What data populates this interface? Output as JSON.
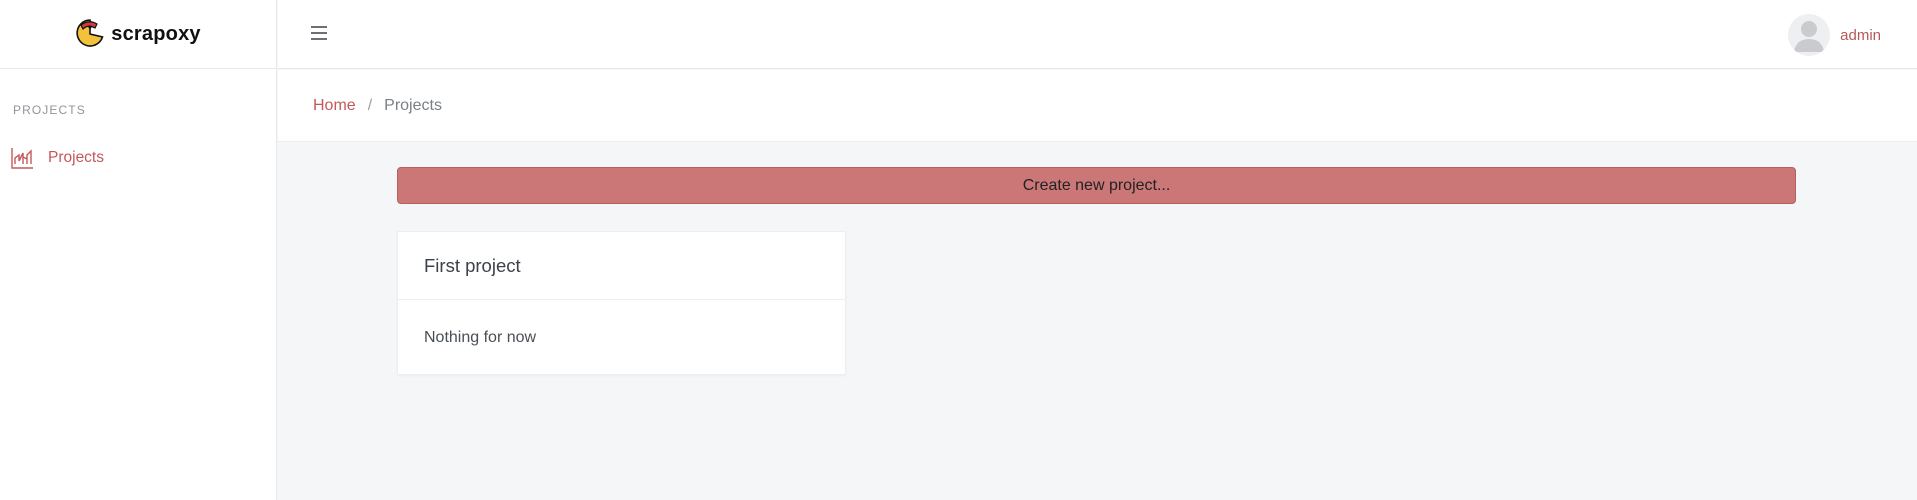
{
  "brand": {
    "name": "scrapoxy"
  },
  "sidebar": {
    "section_title": "PROJECTS",
    "items": [
      {
        "label": "Projects",
        "icon": "chart-icon"
      }
    ]
  },
  "topbar": {
    "menu_icon": "hamburger-icon",
    "user": {
      "name": "admin",
      "avatar_icon": "user-avatar-icon"
    }
  },
  "breadcrumb": {
    "home": "Home",
    "separator": "/",
    "current": "Projects"
  },
  "main": {
    "create_button_label": "Create new project...",
    "projects": [
      {
        "title": "First project",
        "body": "Nothing for now"
      }
    ]
  },
  "colors": {
    "accent": "#c4585b",
    "button_bg": "#cb7778",
    "background": "#f5f6f8"
  }
}
